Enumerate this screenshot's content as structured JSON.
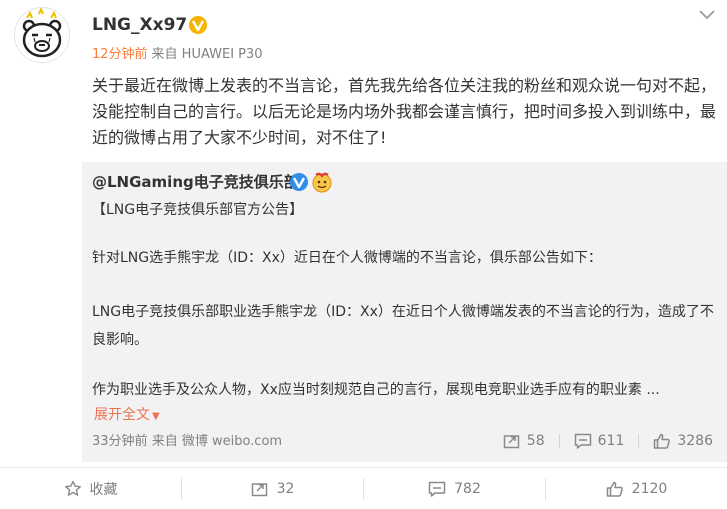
{
  "post": {
    "username": "LNG_Xx97",
    "time": "12分钟前",
    "source": "来自 HUAWEI P30",
    "text": "关于最近在微博上发表的不当言论，首先我先给各位关注我的粉丝和观众说一句对不起，没能控制自己的言行。以后无论是场内场外我都会谨言慎行，把时间多投入到训练中，最近的微博占用了大家不少时间，对不住了!"
  },
  "repost": {
    "author": "@LNGaming电子竞技俱乐部",
    "line1": "【LNG电子竞技俱乐部官方公告】",
    "line2": "针对LNG选手熊宇龙（ID：Xx）近日在个人微博端的不当言论，俱乐部公告如下：",
    "line3": "LNG电子竞技俱乐部职业选手熊宇龙（ID：Xx）在近日个人微博端发表的不当言论的行为，造成了不良影响。",
    "line4": "作为职业选手及公众人物，Xx应当时刻规范自己的言行，展现电竞职业选手应有的职业素 ...",
    "expand_label": "展开全文",
    "time": "33分钟前",
    "source": "来自 微博 weibo.com",
    "reposts": "58",
    "comments": "611",
    "likes": "3286"
  },
  "actions": {
    "favorite_label": "收藏",
    "repost_count": "32",
    "comment_count": "782",
    "like_count": "2120"
  },
  "colors": {
    "time_orange": "#fa7d3c",
    "link_orange": "#eb7350",
    "verified_gold": "#f5b400",
    "verified_blue": "#2d8fe8",
    "repost_bg": "#f2f2f5"
  },
  "icons": [
    "bear-avatar",
    "verified-gold-icon",
    "chevron-down-icon",
    "verified-blue-icon",
    "emoji-badge-icon",
    "repost-icon",
    "comment-icon",
    "like-icon",
    "star-icon"
  ]
}
